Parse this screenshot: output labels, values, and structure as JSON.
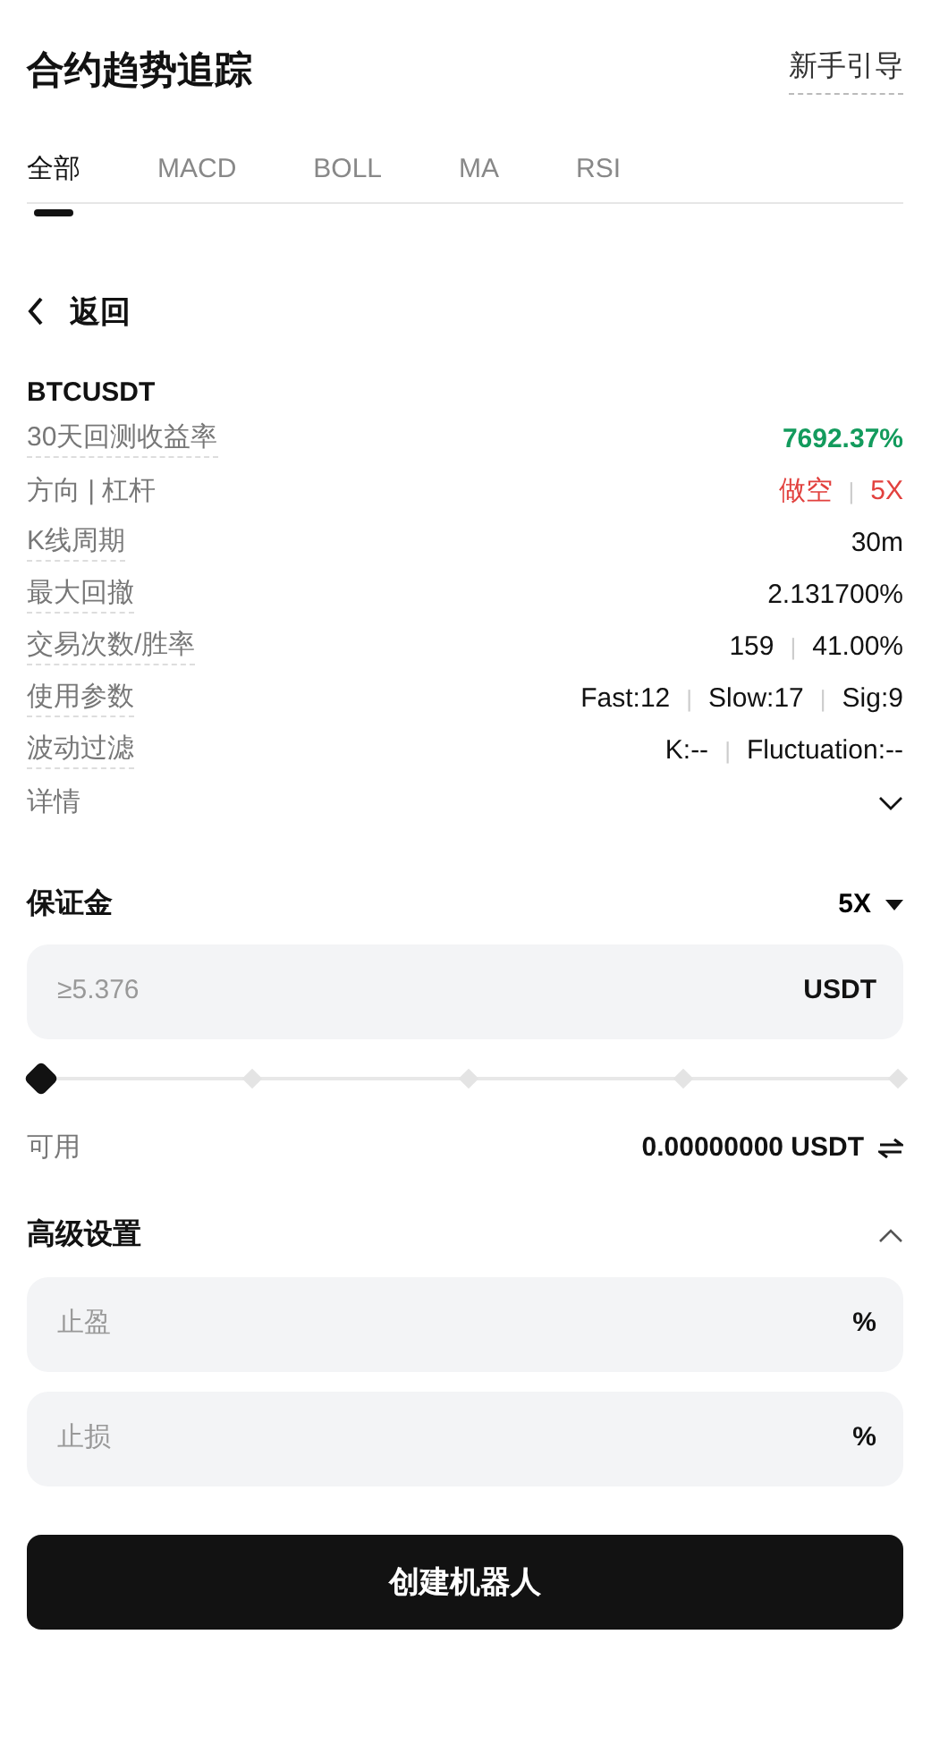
{
  "header": {
    "title": "合约趋势追踪",
    "guide_link": "新手引导"
  },
  "tabs": [
    {
      "label": "全部",
      "selected": true
    },
    {
      "label": "MACD",
      "selected": false
    },
    {
      "label": "BOLL",
      "selected": false
    },
    {
      "label": "MA",
      "selected": false
    },
    {
      "label": "RSI",
      "selected": false
    }
  ],
  "back": {
    "label": "返回"
  },
  "strategy": {
    "symbol": "BTCUSDT",
    "separator": "|",
    "rows": [
      {
        "label": "30天回测收益率",
        "underlined": true,
        "values": [
          {
            "text": "7692.37%",
            "color": "#139b5d"
          }
        ]
      },
      {
        "label": "方向 | 杠杆",
        "underlined": false,
        "values": [
          {
            "text": "做空",
            "color": "#e2413e"
          },
          {
            "text": "5X",
            "color": "#e2413e"
          }
        ]
      },
      {
        "label": "K线周期",
        "underlined": true,
        "values": [
          {
            "text": "30m",
            "color": "#121212"
          }
        ]
      },
      {
        "label": "最大回撤",
        "underlined": true,
        "values": [
          {
            "text": "2.131700%",
            "color": "#121212"
          }
        ]
      },
      {
        "label": "交易次数/胜率",
        "underlined": true,
        "values": [
          {
            "text": "159",
            "color": "#121212"
          },
          {
            "text": "41.00%",
            "color": "#121212"
          }
        ]
      },
      {
        "label": "使用参数",
        "underlined": true,
        "values": [
          {
            "text": "Fast:12",
            "color": "#121212"
          },
          {
            "text": "Slow:17",
            "color": "#121212"
          },
          {
            "text": "Sig:9",
            "color": "#121212"
          }
        ]
      },
      {
        "label": "波动过滤",
        "underlined": true,
        "values": [
          {
            "text": "K:--",
            "color": "#121212"
          },
          {
            "text": "Fluctuation:--",
            "color": "#121212"
          }
        ]
      }
    ],
    "details": {
      "label": "详情",
      "expanded": false
    }
  },
  "margin": {
    "label": "保证金",
    "leverage": "5X",
    "placeholder": "≥5.376",
    "unit": "USDT",
    "level": 0,
    "available_label": "可用",
    "available_value": "0.00000000 USDT"
  },
  "advanced": {
    "label": "高级设置",
    "expanded": true,
    "fields": [
      {
        "placeholder": "止盈",
        "unit": "%"
      },
      {
        "placeholder": "止损",
        "unit": "%"
      }
    ]
  },
  "submit": {
    "label": "创建机器人"
  }
}
